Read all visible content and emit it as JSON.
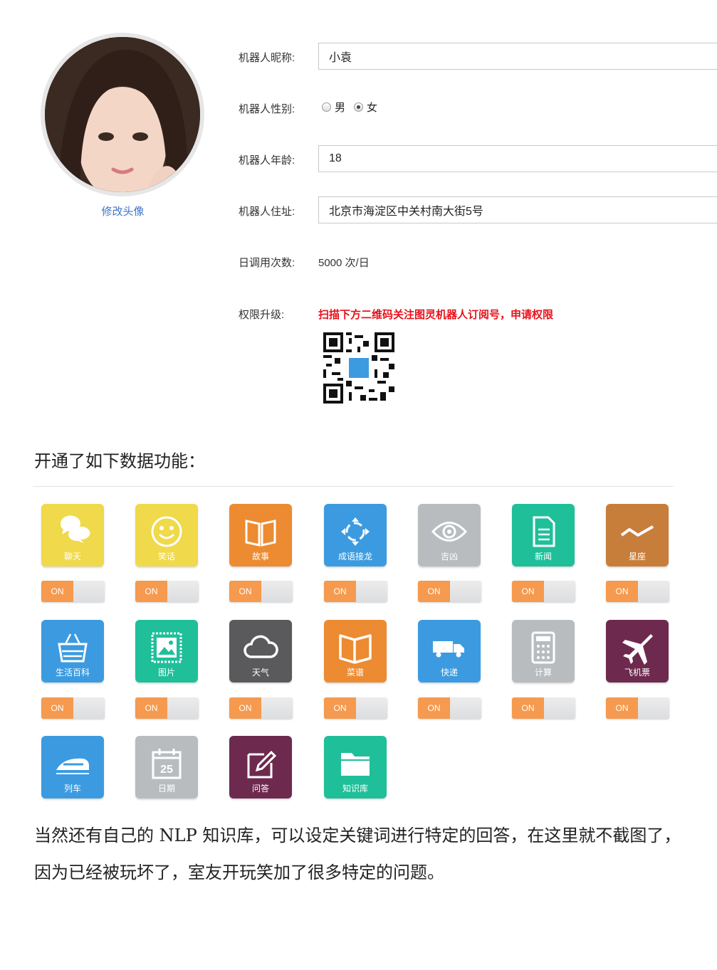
{
  "profile": {
    "change_avatar": "修改头像",
    "nickname_label": "机器人昵称:",
    "nickname_value": "小袁",
    "gender_label": "机器人性别:",
    "gender_male": "男",
    "gender_female": "女",
    "gender_selected": "女",
    "age_label": "机器人年龄:",
    "age_value": "18",
    "address_label": "机器人住址:",
    "address_value": "北京市海淀区中关村南大街5号",
    "daily_calls_label": "日调用次数:",
    "daily_calls_value": "5000 次/日",
    "upgrade_label": "权限升级:",
    "upgrade_note": "扫描下方二维码关注图灵机器人订阅号，申请权限"
  },
  "article": {
    "section_title": "开通了如下数据功能：",
    "paragraph": "当然还有自己的 NLP 知识库，可以设定关键词进行特定的回答，在这里就不截图了，因为已经被玩坏了，室友开玩笑加了很多特定的问题。"
  },
  "features": [
    {
      "label": "聊天",
      "color": "#f0d94a",
      "icon": "chat-icon",
      "toggle": "ON"
    },
    {
      "label": "笑话",
      "color": "#f0d94a",
      "icon": "smile-icon",
      "toggle": "ON"
    },
    {
      "label": "故事",
      "color": "#ec8b32",
      "icon": "book-icon",
      "toggle": "ON"
    },
    {
      "label": "成语接龙",
      "color": "#3c9be0",
      "icon": "cycle-icon",
      "toggle": "ON"
    },
    {
      "label": "吉凶",
      "color": "#b9bcbf",
      "icon": "eye-icon",
      "toggle": "ON"
    },
    {
      "label": "新闻",
      "color": "#1fbf9a",
      "icon": "document-icon",
      "toggle": "ON"
    },
    {
      "label": "星座",
      "color": "#c87e3b",
      "icon": "zigzag-icon",
      "toggle": "ON"
    },
    {
      "label": "生活百科",
      "color": "#3c9be0",
      "icon": "basket-icon",
      "toggle": "ON"
    },
    {
      "label": "图片",
      "color": "#1fbf9a",
      "icon": "picture-icon",
      "toggle": "ON"
    },
    {
      "label": "天气",
      "color": "#5a5a5c",
      "icon": "cloud-icon",
      "toggle": "ON"
    },
    {
      "label": "菜谱",
      "color": "#ec8b32",
      "icon": "open-book-icon",
      "toggle": "ON"
    },
    {
      "label": "快递",
      "color": "#3c9be0",
      "icon": "truck-icon",
      "toggle": "ON"
    },
    {
      "label": "计算",
      "color": "#b9bcbf",
      "icon": "calculator-icon",
      "toggle": "ON"
    },
    {
      "label": "飞机票",
      "color": "#6d2a4e",
      "icon": "airplane-icon",
      "toggle": "ON"
    },
    {
      "label": "列车",
      "color": "#3c9be0",
      "icon": "train-icon",
      "toggle": ""
    },
    {
      "label": "日期",
      "color": "#b9bcbf",
      "icon": "calendar-icon",
      "toggle": "",
      "calendar_day": "25"
    },
    {
      "label": "问答",
      "color": "#6d2a4e",
      "icon": "edit-icon",
      "toggle": ""
    },
    {
      "label": "知识库",
      "color": "#1fbf9a",
      "icon": "folder-icon",
      "toggle": ""
    }
  ]
}
